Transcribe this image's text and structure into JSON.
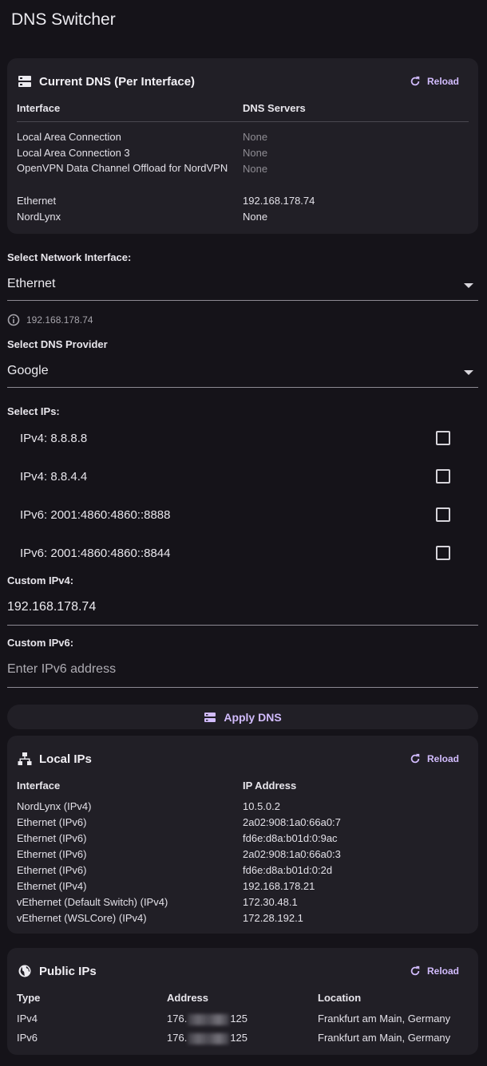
{
  "app": {
    "title": "DNS Switcher"
  },
  "current_dns": {
    "title": "Current DNS (Per Interface)",
    "icon": "server-icon",
    "reload_label": "Reload",
    "headers": {
      "interface": "Interface",
      "dns": "DNS Servers"
    },
    "rows": [
      {
        "interface": "Local Area Connection",
        "dns": "None"
      },
      {
        "interface": "Local Area Connection 3",
        "dns": "None"
      },
      {
        "interface": "OpenVPN Data Channel Offload for NordVPN",
        "dns": "None"
      },
      {
        "interface": "Ethernet",
        "dns": "192.168.178.74"
      },
      {
        "interface": "NordLynx",
        "dns": "None"
      }
    ]
  },
  "interface_select": {
    "label": "Select Network Interface:",
    "value": "Ethernet",
    "hint": "192.168.178.74"
  },
  "provider_select": {
    "label": "Select DNS Provider",
    "value": "Google"
  },
  "ips": {
    "label": "Select IPs:",
    "options": [
      {
        "label": "IPv4: 8.8.8.8",
        "checked": false
      },
      {
        "label": "IPv4: 8.8.4.4",
        "checked": false
      },
      {
        "label": "IPv6: 2001:4860:4860::8888",
        "checked": false
      },
      {
        "label": "IPv6: 2001:4860:4860::8844",
        "checked": false
      }
    ]
  },
  "custom_ipv4": {
    "label": "Custom IPv4:",
    "value": "192.168.178.74"
  },
  "custom_ipv6": {
    "label": "Custom IPv6:",
    "value": "",
    "placeholder": "Enter IPv6 address"
  },
  "apply": {
    "label": "Apply DNS"
  },
  "local_ips": {
    "title": "Local IPs",
    "icon": "network-icon",
    "reload_label": "Reload",
    "headers": {
      "interface": "Interface",
      "ip": "IP Address"
    },
    "rows": [
      {
        "interface": "NordLynx (IPv4)",
        "ip": "10.5.0.2"
      },
      {
        "interface": "Ethernet (IPv6)",
        "ip": "2a02:908:1a0:66a0:7"
      },
      {
        "interface": "Ethernet (IPv6)",
        "ip": "fd6e:d8a:b01d:0:9ac"
      },
      {
        "interface": "Ethernet (IPv6)",
        "ip": "2a02:908:1a0:66a0:3"
      },
      {
        "interface": "Ethernet (IPv6)",
        "ip": "fd6e:d8a:b01d:0:2d"
      },
      {
        "interface": "Ethernet (IPv4)",
        "ip": "192.168.178.21"
      },
      {
        "interface": "vEthernet (Default Switch) (IPv4)",
        "ip": "172.30.48.1"
      },
      {
        "interface": "vEthernet (WSLCore) (IPv4)",
        "ip": "172.28.192.1"
      }
    ]
  },
  "public_ips": {
    "title": "Public IPs",
    "icon": "globe-icon",
    "reload_label": "Reload",
    "headers": {
      "type": "Type",
      "address": "Address",
      "location": "Location"
    },
    "rows": [
      {
        "type": "IPv4",
        "address_start": "176.",
        "address_end": "125",
        "location": "Frankfurt am Main, Germany"
      },
      {
        "type": "IPv6",
        "address_start": "176.",
        "address_end": "125",
        "location": "Frankfurt am Main, Germany"
      }
    ]
  },
  "colors": {
    "background": "#151319",
    "card": "#211f26",
    "accent": "#d2bcfd",
    "muted": "#8e8c93"
  }
}
